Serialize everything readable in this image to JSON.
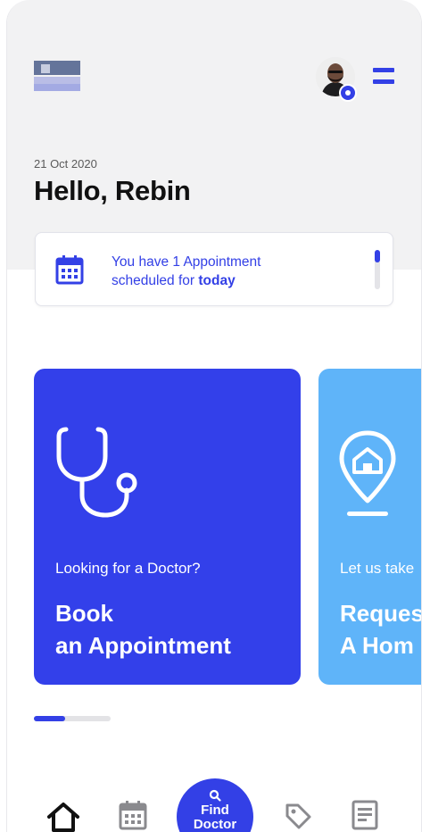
{
  "header": {
    "date": "21 Oct 2020",
    "greeting": "Hello, Rebin"
  },
  "appointment_banner": {
    "line1": "You have 1 Appointment",
    "line2_prefix": "scheduled for ",
    "line2_bold": "today"
  },
  "cards": [
    {
      "subtitle": "Looking for a Doctor?",
      "title_line1": "Book",
      "title_line2": "an Appointment",
      "icon": "stethoscope-icon",
      "color": "#3340ea"
    },
    {
      "subtitle": "Let us take",
      "title_line1": "Reques",
      "title_line2": "A Hom",
      "icon": "home-location-icon",
      "color": "#5fb4f9"
    }
  ],
  "bottom_nav": {
    "items": [
      "home-icon",
      "calendar-icon",
      "tag-icon",
      "document-icon"
    ],
    "fab_line1": "Find",
    "fab_line2": "Doctor"
  },
  "colors": {
    "accent": "#3340e6",
    "background_top": "#f2f2f3",
    "card_primary": "#3340ea",
    "card_secondary": "#5fb4f9"
  }
}
